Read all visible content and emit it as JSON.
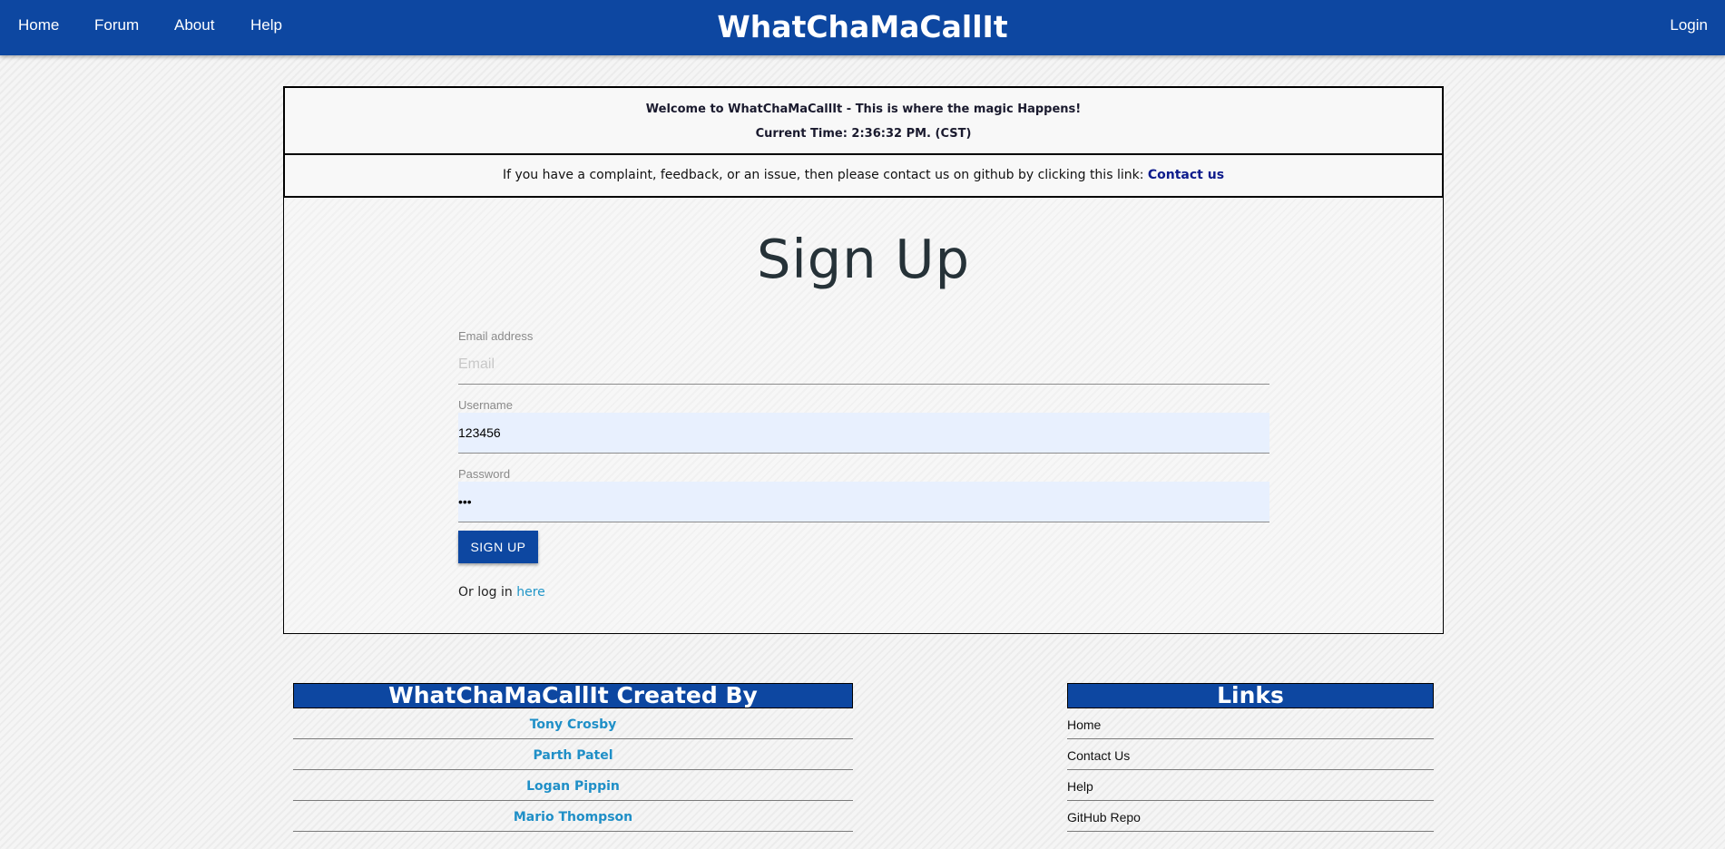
{
  "navbar": {
    "brand": "WhatChaMaCallIt",
    "links": [
      "Home",
      "Forum",
      "About",
      "Help"
    ],
    "login": "Login"
  },
  "welcome": {
    "line1": "Welcome to WhatChaMaCallIt - This is where the magic Happens!",
    "line2": "Current Time: 2:36:32 PM. (CST)"
  },
  "contact": {
    "text": "If you have a complaint, feedback, or an issue, then please contact us on github by clicking this link: ",
    "link": "Contact us"
  },
  "signup": {
    "title": "Sign Up",
    "email_label": "Email address",
    "email_placeholder": "Email",
    "email_value": "",
    "username_label": "Username",
    "username_value": "123456",
    "password_label": "Password",
    "password_value": "123",
    "submit": "SIGN UP",
    "login_prefix": "Or log in ",
    "login_link": "here"
  },
  "footer": {
    "creators_heading": "WhatChaMaCallIt Created By",
    "creators": [
      "Tony Crosby",
      "Parth Patel",
      "Logan Pippin",
      "Mario Thompson"
    ],
    "links_heading": "Links",
    "links": [
      "Home",
      "Contact Us",
      "Help",
      "GitHub Repo"
    ]
  },
  "colors": {
    "primary": "#0d47a1",
    "link_blue": "#2196c8",
    "autofill_bg": "#e8f0fe"
  }
}
